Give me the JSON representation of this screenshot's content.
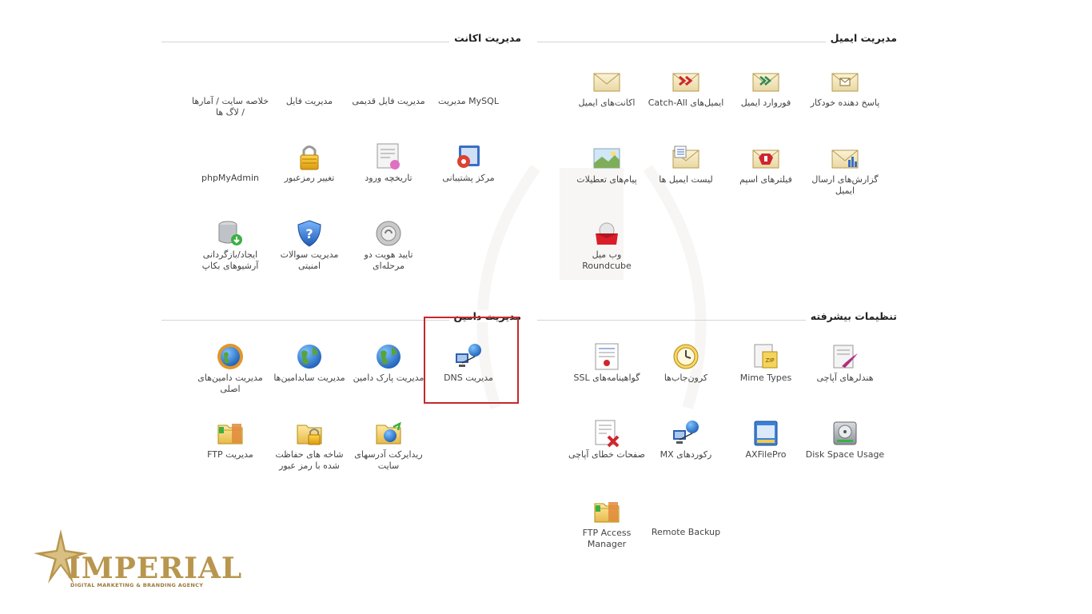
{
  "sections": {
    "email": {
      "title": "مدیریت ایمیل",
      "items": [
        {
          "label": "پاسخ دهنده خودکار",
          "icon": "autoresponder-envelope-icon"
        },
        {
          "label": "فوروارد ایمیل",
          "icon": "forward-envelope-icon"
        },
        {
          "label": "ایمیل‌های Catch-All",
          "icon": "catch-all-envelope-icon"
        },
        {
          "label": "اکانت‌های ایمیل",
          "icon": "envelope-icon"
        },
        {
          "label": "گزارش‌های ارسال ایمیل",
          "icon": "email-report-icon"
        },
        {
          "label": "فیلترهای اسپم",
          "icon": "spam-filter-icon"
        },
        {
          "label": "لیست ایمیل ها",
          "icon": "mailing-list-icon"
        },
        {
          "label": "پیام‌های تعطیلات",
          "icon": "vacation-message-icon"
        },
        {
          "label": "وب میل Roundcube",
          "icon": "roundcube-icon"
        }
      ]
    },
    "account": {
      "title": "مدیریت اکانت",
      "items": [
        {
          "label": "مدیریت MySQL",
          "icon": "mysql-icon"
        },
        {
          "label": "مدیریت فایل قدیمی",
          "icon": "legacy-file-manager-icon"
        },
        {
          "label": "مدیریت فایل",
          "icon": "file-manager-icon"
        },
        {
          "label": "خلاصه سایت / آمارها / لاگ ها",
          "icon": "site-summary-icon"
        },
        {
          "label": "مرکز پشتیبانی",
          "icon": "support-center-icon"
        },
        {
          "label": "تاریخچه ورود",
          "icon": "login-history-icon"
        },
        {
          "label": "تغییر رمزعبور",
          "icon": "padlock-icon"
        },
        {
          "label": "phpMyAdmin",
          "icon": "phpmyadmin-icon"
        },
        {
          "label": "تایید هویت دو مرحله‌ای",
          "icon": "two-factor-icon"
        },
        {
          "label": "مدیریت سوالات امنیتی",
          "icon": "security-shield-icon"
        },
        {
          "label": "ایجاد/بازگردانی آرشیوهای بکاپ",
          "icon": "backup-database-icon"
        }
      ]
    },
    "advanced": {
      "title": "تنظیمات بیشرفته",
      "items": [
        {
          "label": "هندلرهای آپاچی",
          "icon": "apache-handler-icon"
        },
        {
          "label": "Mime Types",
          "icon": "mime-types-icon"
        },
        {
          "label": "کرون‌جاب‌ها",
          "icon": "clock-icon"
        },
        {
          "label": "گواهینامه‌های SSL",
          "icon": "ssl-certificate-icon"
        },
        {
          "label": "Disk Space Usage",
          "icon": "disk-space-icon"
        },
        {
          "label": "AXFilePro",
          "icon": "axfilepro-icon"
        },
        {
          "label": "رکوردهای MX",
          "icon": "mx-records-icon"
        },
        {
          "label": "صفحات خطای آپاچی",
          "icon": "error-pages-icon"
        },
        {
          "label": "FTP Access Manager",
          "icon": "ftp-folder-icon"
        },
        {
          "label": "Remote Backup",
          "icon": "remote-backup-icon"
        }
      ]
    },
    "domain": {
      "title": "مدیریت دامین",
      "items": [
        {
          "label": "مدیریت DNS",
          "icon": "dns-globe-icon"
        },
        {
          "label": "مدیریت پارک دامین",
          "icon": "globe-icon"
        },
        {
          "label": "مدیریت سابدامین‌ها",
          "icon": "globe-icon"
        },
        {
          "label": "مدیریت دامین‌های اصلی",
          "icon": "globe-gear-icon"
        },
        {
          "label": "ریدایرکت آدرسهای سایت",
          "icon": "redirect-folder-icon"
        },
        {
          "label": "شاخه های حفاظت شده با رمز عبور",
          "icon": "locked-folder-icon"
        },
        {
          "label": "مدیریت FTP",
          "icon": "ftp-folder-icon"
        }
      ]
    }
  },
  "logo": {
    "brand": "IMPERIAL",
    "tagline": "DIGITAL MARKETING & BRANDING AGENCY"
  },
  "colors": {
    "highlight": "#c6282c",
    "brand_gold": "#b8964d"
  }
}
